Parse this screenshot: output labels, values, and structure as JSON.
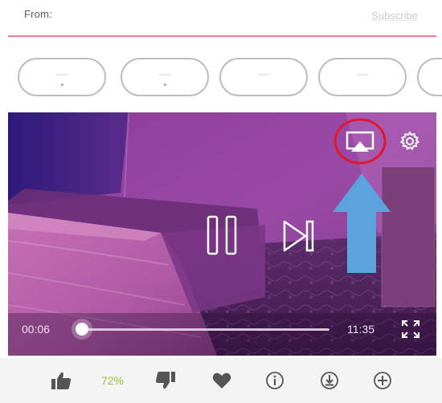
{
  "header": {
    "from_label": "From:",
    "subscribe_label": "Subscribe"
  },
  "tags": {
    "count": 5
  },
  "player": {
    "current_time": "00:06",
    "duration": "11:35",
    "progress_fraction": 0.009,
    "state": "playing",
    "annotation": {
      "circle_color": "#e0182b",
      "arrow_color": "#5aa3dd"
    },
    "icons": [
      "airplay-icon",
      "settings-gear-icon",
      "pause-icon",
      "skip-next-icon",
      "fullscreen-icon"
    ]
  },
  "actions": {
    "like_percent": "72%",
    "icons": [
      "thumbs-up-icon",
      "thumbs-down-icon",
      "heart-icon",
      "info-icon",
      "download-icon",
      "add-icon"
    ],
    "accent_color": "#9bbf3a"
  },
  "colors": {
    "brand_line": "#f07d95",
    "video_tint": "#6a2a78"
  }
}
